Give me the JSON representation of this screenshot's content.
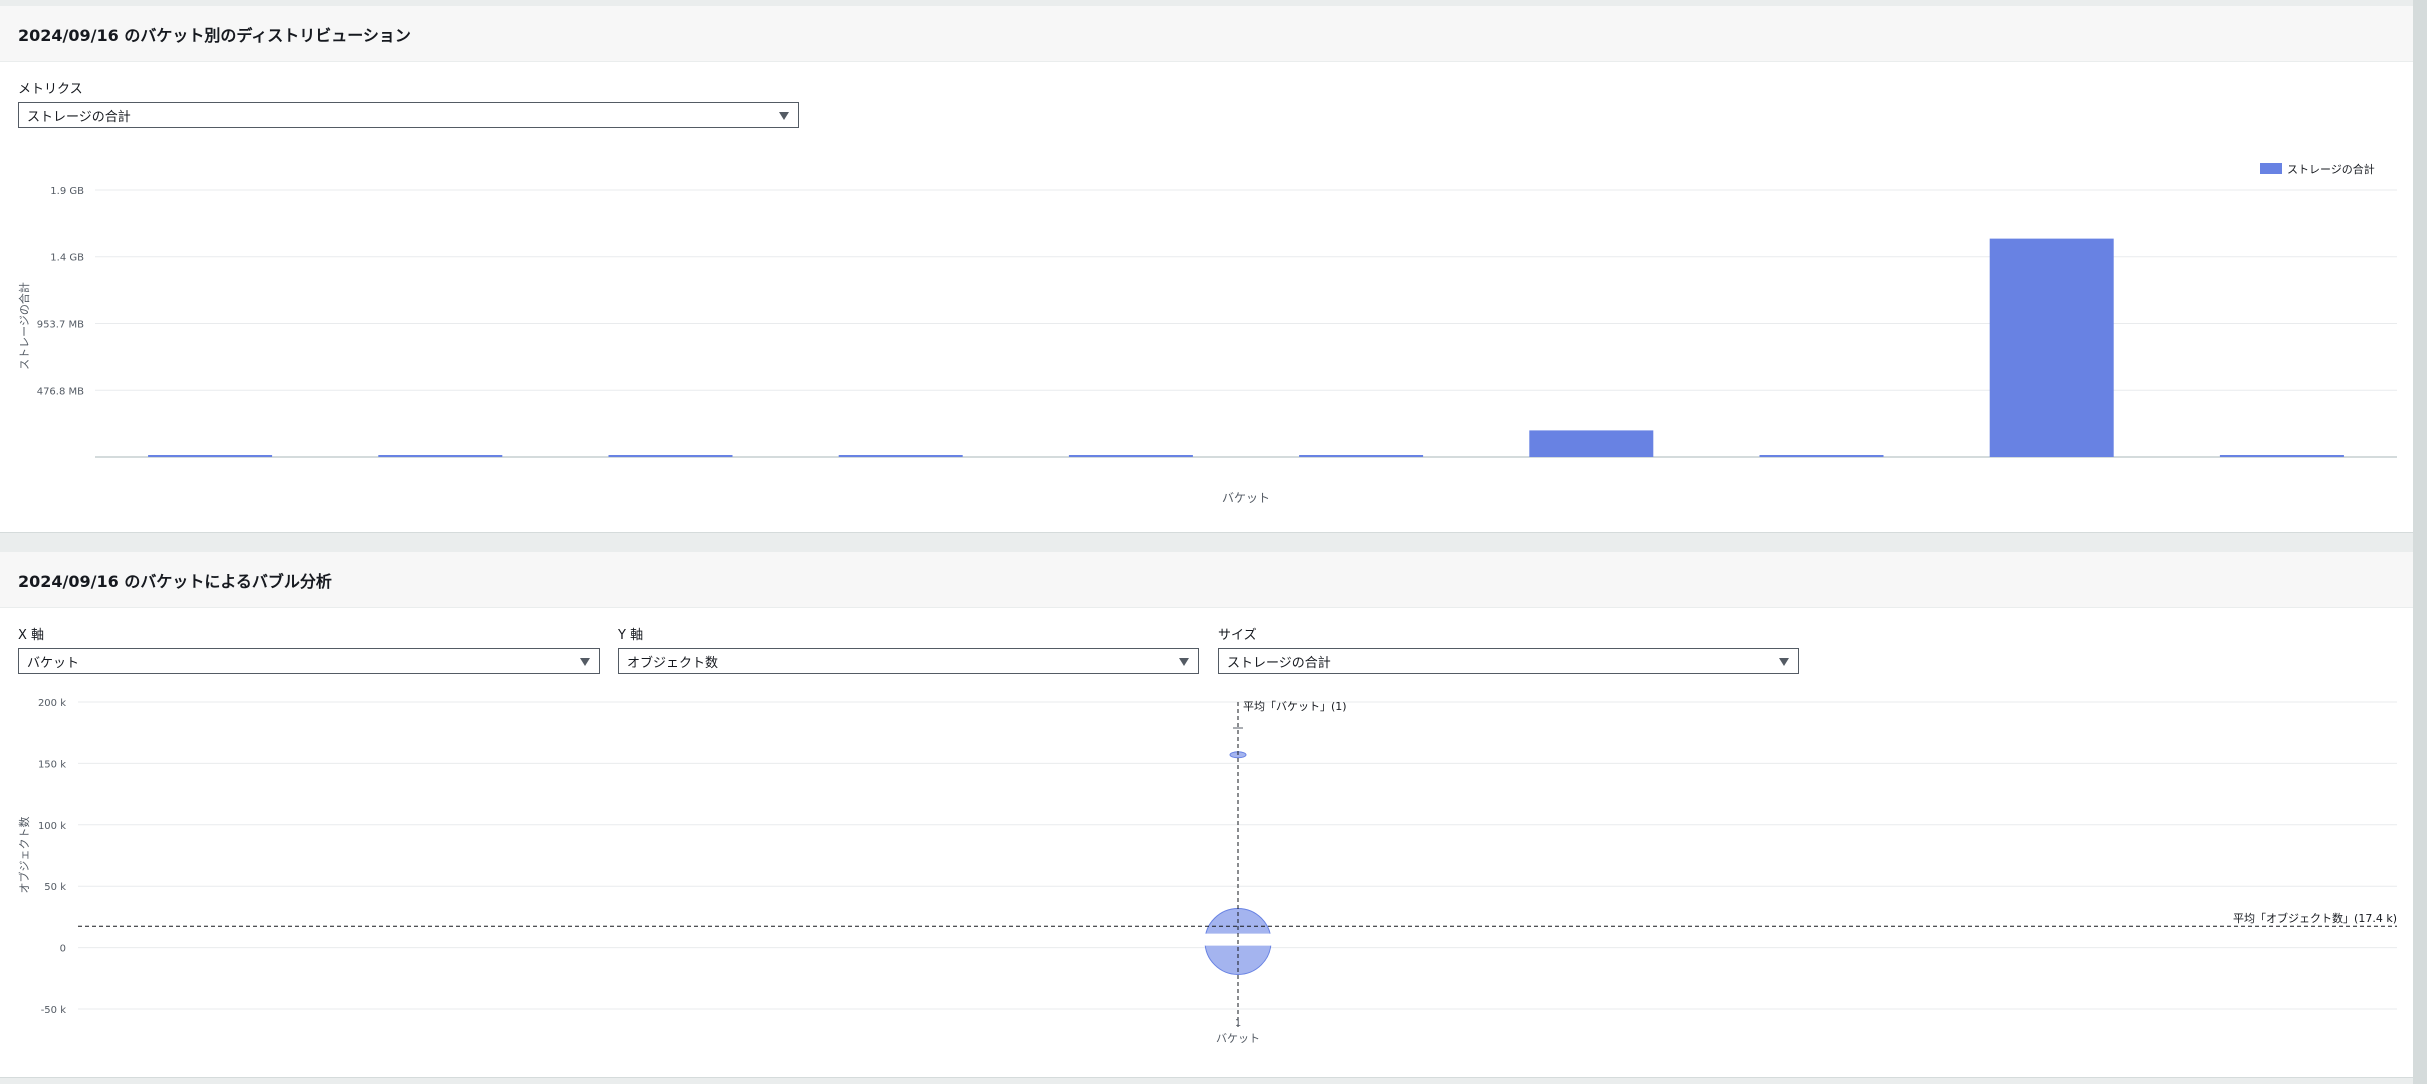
{
  "distribution": {
    "title": "2024/09/16 のバケット別のディストリビューション",
    "metric_label": "メトリクス",
    "metric_value": "ストレージの合計"
  },
  "bubble": {
    "title": "2024/09/16 のバケットによるバブル分析",
    "x_label": "X 軸",
    "x_value": "バケット",
    "y_label": "Y 軸",
    "y_value": "オブジェクト数",
    "size_label": "サイズ",
    "size_value": "ストレージの合計"
  },
  "colors": {
    "bar": "#6882e3",
    "bubble": "#a4b4ef",
    "bubble_stroke": "#6882e3"
  },
  "chart_data": [
    {
      "type": "bar",
      "xlabel": "バケット",
      "ylabel": "ストレージの合計",
      "y_ticks": [
        "476.8 MB",
        "953.7 MB",
        "1.4 GB",
        "1.9 GB"
      ],
      "ylim_mb": [
        0,
        1907.3
      ],
      "legend": "ストレージの合計",
      "legend_position": "top-right",
      "values_mb": [
        5,
        5,
        5,
        5,
        5,
        5,
        190,
        5,
        1560,
        5
      ]
    },
    {
      "type": "scatter",
      "xlabel": "バケット",
      "ylabel": "オブジェクト数",
      "y_ticks": [
        "-50 k",
        "0",
        "50 k",
        "100 k",
        "150 k",
        "200 k"
      ],
      "ylim": [
        -50000,
        200000
      ],
      "x_tick": "1",
      "points": [
        {
          "x": 1,
          "y": 5000,
          "size": "large"
        },
        {
          "x": 1,
          "y": 157000,
          "size": "small"
        }
      ],
      "avg_x_label": "平均「バケット」(1)",
      "avg_y_label": "平均「オブジェクト数」(17.4 k)",
      "avg_y": 17400
    }
  ]
}
